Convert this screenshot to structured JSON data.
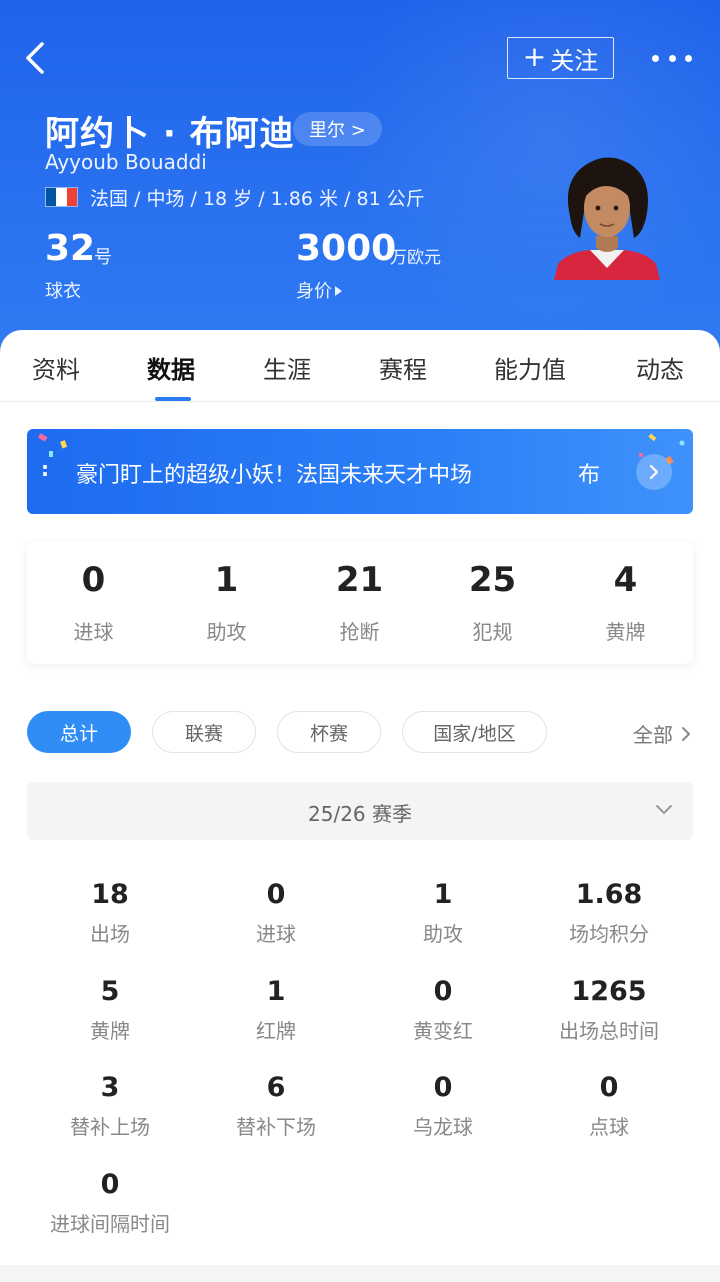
{
  "header": {
    "follow_label": "关注",
    "player_name": "阿约卜 · 布阿迪",
    "club": "里尔 >",
    "player_name_en": "Ayyoub Bouaddi",
    "info": "法国 / 中场 / 18 岁 / 1.86 米 / 81 公斤",
    "flag_colors": [
      "#0055a4",
      "#ffffff",
      "#ef4135"
    ],
    "jersey_number": "32",
    "jersey_suffix": "号",
    "jersey_label": "球衣",
    "market_value": "3000",
    "market_value_unit": "万欧元",
    "market_value_label": "身价"
  },
  "tabs": [
    {
      "label": "资料"
    },
    {
      "label": "数据"
    },
    {
      "label": "生涯"
    },
    {
      "label": "赛程"
    },
    {
      "label": "能力值"
    },
    {
      "label": "动态"
    }
  ],
  "active_tab": "数据",
  "banner": {
    "text": "豪门盯上的超级小妖！法国未来天才中场",
    "text_tail": "布"
  },
  "summary": [
    {
      "value": "0",
      "label": "进球"
    },
    {
      "value": "1",
      "label": "助攻"
    },
    {
      "value": "21",
      "label": "抢断"
    },
    {
      "value": "25",
      "label": "犯规"
    },
    {
      "value": "4",
      "label": "黄牌"
    }
  ],
  "filters": [
    {
      "label": "总计",
      "active": true
    },
    {
      "label": "联赛",
      "active": false
    },
    {
      "label": "杯赛",
      "active": false
    },
    {
      "label": "国家/地区",
      "active": false
    }
  ],
  "all_label": "全部",
  "season": "25/26 赛季",
  "stats": [
    {
      "value": "18",
      "label": "出场"
    },
    {
      "value": "0",
      "label": "进球"
    },
    {
      "value": "1",
      "label": "助攻"
    },
    {
      "value": "1.68",
      "label": "场均积分"
    },
    {
      "value": "5",
      "label": "黄牌"
    },
    {
      "value": "1",
      "label": "红牌"
    },
    {
      "value": "0",
      "label": "黄变红"
    },
    {
      "value": "1265",
      "label": "出场总时间"
    },
    {
      "value": "3",
      "label": "替补上场"
    },
    {
      "value": "6",
      "label": "替补下场"
    },
    {
      "value": "0",
      "label": "乌龙球"
    },
    {
      "value": "0",
      "label": "点球"
    },
    {
      "value": "0",
      "label": "进球间隔时间"
    }
  ],
  "colors": {
    "header_blue": "#1f63ea",
    "accent_blue": "#2f8df5"
  }
}
